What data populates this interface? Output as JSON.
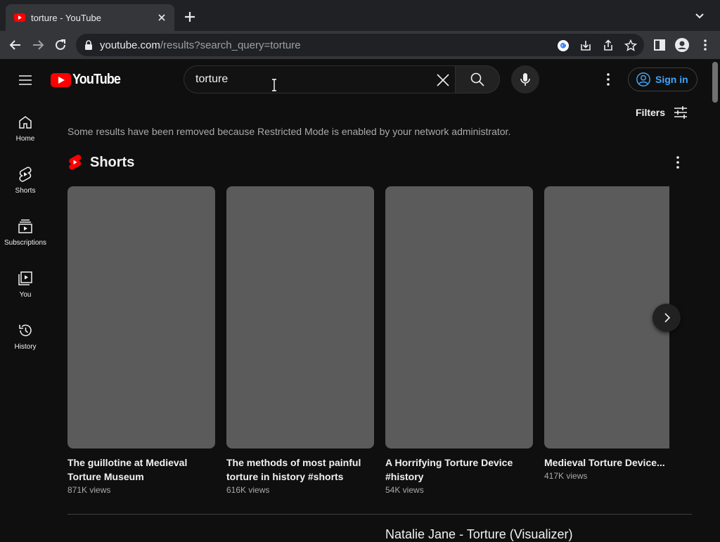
{
  "browser": {
    "tab_title": "torture - YouTube",
    "url_host": "youtube.com",
    "url_rest": "/results?search_query=torture"
  },
  "header": {
    "logo_text": "YouTube",
    "search_value": "torture",
    "search_placeholder": "Search",
    "signin_label": "Sign in"
  },
  "sidebar": {
    "items": [
      {
        "label": "Home",
        "icon": "home-icon"
      },
      {
        "label": "Shorts",
        "icon": "shorts-icon"
      },
      {
        "label": "Subscriptions",
        "icon": "subscriptions-icon"
      },
      {
        "label": "You",
        "icon": "you-icon"
      },
      {
        "label": "History",
        "icon": "history-icon"
      }
    ]
  },
  "main": {
    "filters_label": "Filters",
    "notice": "Some results have been removed because Restricted Mode is enabled by your network administrator.",
    "shorts_title": "Shorts",
    "shorts": [
      {
        "title": "The guillotine at Medieval Torture Museum",
        "views": "871K views"
      },
      {
        "title": "The methods of most painful torture in history #shorts",
        "views": "616K views"
      },
      {
        "title": "A Horrifying Torture Device #history",
        "views": "54K views"
      },
      {
        "title": "Medieval Torture Device...",
        "views": "417K views"
      }
    ],
    "next_video_title": "Natalie Jane - Torture (Visualizer)"
  },
  "colors": {
    "background": "#0f0f0f",
    "accent_red": "#ff0000",
    "link_blue": "#3ea6ff",
    "thumb_placeholder": "#5b5b5b"
  }
}
